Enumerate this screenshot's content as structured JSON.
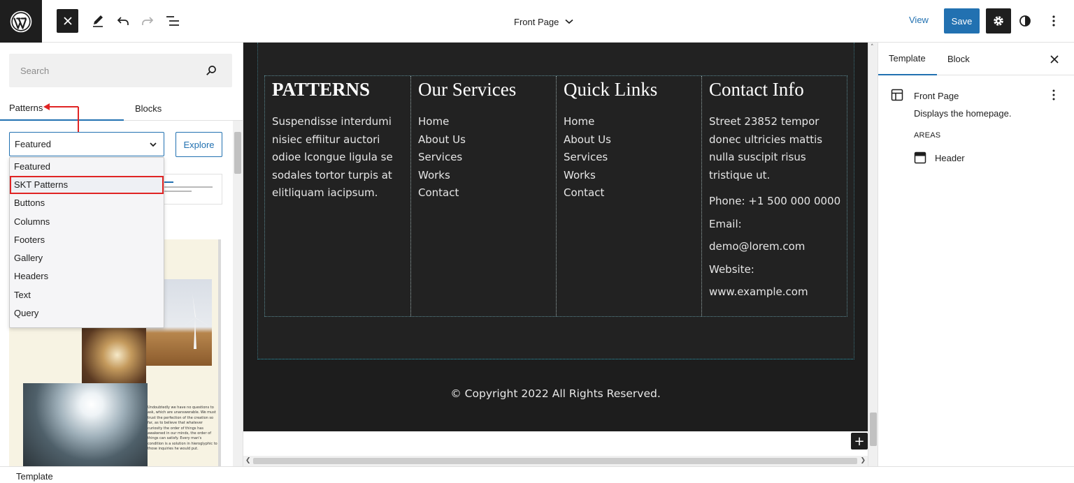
{
  "topbar": {
    "document_title": "Front Page",
    "view_label": "View",
    "save_label": "Save"
  },
  "inserter": {
    "search_placeholder": "Search",
    "tabs": [
      "Patterns",
      "Blocks"
    ],
    "selected_category": "Featured",
    "explore_label": "Explore",
    "categories": [
      "Featured",
      "SKT Patterns",
      "Buttons",
      "Columns",
      "Footers",
      "Gallery",
      "Headers",
      "Text",
      "Query"
    ],
    "highlighted_category": "SKT Patterns",
    "preview_text": "Undoubtedly we have no questions to ask, which are unanswerable. We must trust the perfection of the creation so far, as to believe that whatever curiosity the order of things has awakened in our minds, the order of things can satisfy. Every man's condition is a solution in hieroglyphic to those inquiries he would put."
  },
  "canvas": {
    "col1": {
      "heading": "PATTERNS",
      "text": "Suspendisse interdumi nisiec effiitur auctori odioe lcongue ligula se sodales tortor turpis at elitliquam iacipsum."
    },
    "col2": {
      "heading": "Our Services",
      "links": [
        "Home",
        "About Us",
        "Services",
        "Works",
        "Contact"
      ]
    },
    "col3": {
      "heading": "Quick Links",
      "links": [
        "Home",
        "About Us",
        "Services",
        "Works",
        "Contact"
      ]
    },
    "col4": {
      "heading": "Contact Info",
      "address": "Street 23852 tempor donec ultricies mattis nulla suscipit risus tristique ut.",
      "lines": [
        "Phone: +1 500 000 0000",
        "Email:",
        "demo@lorem.com",
        "Website:",
        "www.example.com"
      ]
    },
    "copyright": "© Copyright 2022 All Rights Reserved."
  },
  "settings": {
    "tabs": [
      "Template",
      "Block"
    ],
    "template_title": "Front Page",
    "template_desc": "Displays the homepage.",
    "areas_label": "AREAS",
    "area_item": "Header"
  },
  "footer": {
    "breadcrumb": "Template"
  },
  "colors": {
    "accent": "#2271b1",
    "highlight": "#e02424",
    "canvas_dark": "#1d1d1d"
  }
}
